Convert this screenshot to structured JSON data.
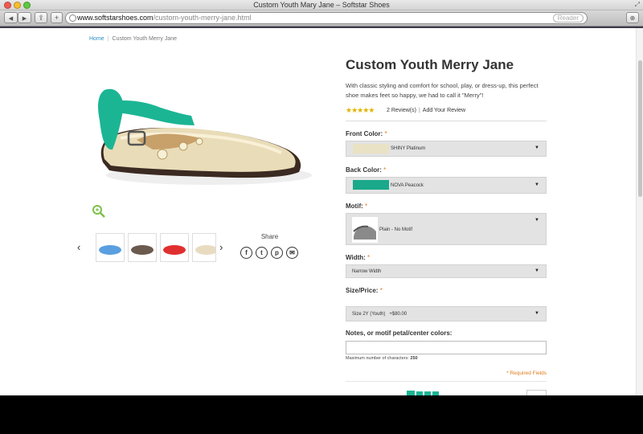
{
  "browser": {
    "window_title": "Custom Youth Mary Jane – Softstar Shoes",
    "url_host": "www.softstarshoes.com",
    "url_path": "/custom-youth-merry-jane.html",
    "reader_label": "Reader",
    "back_icon": "◀",
    "forward_icon": "▶",
    "share_icon": "⇪",
    "add_icon": "+",
    "traffic_colors": [
      "#ee5c54",
      "#f6be2f",
      "#5cc93f"
    ]
  },
  "breadcrumb": {
    "home": "Home",
    "separator": "|",
    "current": "Custom Youth Merry Jane"
  },
  "gallery": {
    "prev_icon": "‹",
    "next_icon": "›",
    "share_label": "Share",
    "social": [
      "f",
      "t",
      "p",
      "✉"
    ],
    "thumb_colors": [
      "#5a9fe0",
      "#6b5a4e",
      "#e02f2f",
      "#e8dcc0"
    ]
  },
  "product": {
    "title": "Custom Youth Merry Jane",
    "description": "With classic styling and comfort for school, play, or dress-up, this perfect shoe makes feet so happy, we had to call it \"Merry\"!",
    "stars": "★★★★★",
    "rating": 5,
    "reviews_count": "2 Review(s)",
    "review_separator": "|",
    "add_review": "Add Your Review",
    "accent_color": "#1bb594"
  },
  "options": {
    "front_color": {
      "label": "Front Color:",
      "required": "*",
      "value": "SHINY Platinum",
      "swatch_color": "#e9e2c4"
    },
    "back_color": {
      "label": "Back Color:",
      "required": "*",
      "value": "NOVA Peacock",
      "swatch_color": "#1aa98a"
    },
    "motif": {
      "label": "Motif:",
      "required": "*",
      "value": "Plain - No Motif"
    },
    "width": {
      "label": "Width:",
      "required": "*",
      "value": "Narrow Width"
    },
    "size_price": {
      "label": "Size/Price:",
      "required": "*",
      "value": "Size 2Y (Youth)   +$80.00"
    },
    "caret": "▼"
  },
  "notes": {
    "label": "Notes, or motif petal/center colors:",
    "max_chars_text": "Maximum number of characters:",
    "max_chars_value": "250",
    "value": ""
  },
  "required_fields": "* Required Fields"
}
